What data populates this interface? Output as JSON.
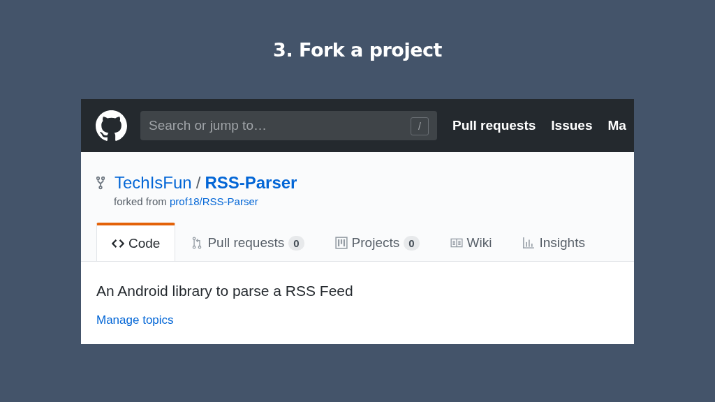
{
  "slide": {
    "title": "3. Fork a project"
  },
  "header": {
    "search": {
      "placeholder": "Search or jump to…",
      "shortcut": "/"
    },
    "nav": [
      "Pull requests",
      "Issues",
      "Ma"
    ]
  },
  "repo": {
    "owner": "TechIsFun",
    "separator": "/",
    "name": "RSS-Parser",
    "forked_prefix": "forked from",
    "forked_source": "prof18/RSS-Parser"
  },
  "tabs": [
    {
      "kind": "code",
      "label": "Code",
      "selected": true
    },
    {
      "kind": "pull",
      "label": "Pull requests",
      "count": "0",
      "selected": false
    },
    {
      "kind": "project",
      "label": "Projects",
      "count": "0",
      "selected": false
    },
    {
      "kind": "wiki",
      "label": "Wiki",
      "selected": false
    },
    {
      "kind": "insights",
      "label": "Insights",
      "selected": false
    }
  ],
  "description": "An Android library to parse a RSS Feed",
  "manage_topics": "Manage topics"
}
